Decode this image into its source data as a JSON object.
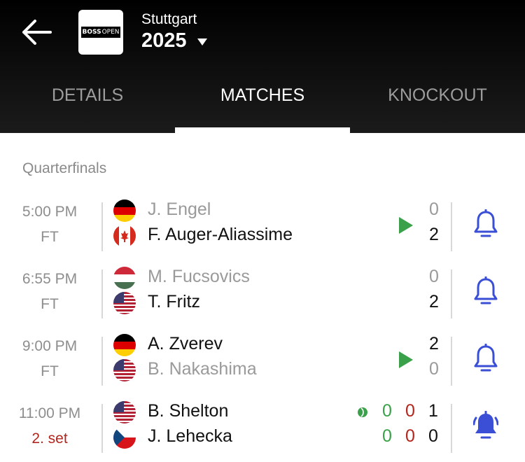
{
  "header": {
    "back_icon": "arrow-left-icon",
    "logo_text_boss": "BOSS",
    "logo_text_open": "OPEN",
    "city": "Stuttgart",
    "year": "2025",
    "year_caret_icon": "caret-down-icon"
  },
  "tabs": [
    {
      "label": "DETAILS",
      "active": false
    },
    {
      "label": "MATCHES",
      "active": true
    },
    {
      "label": "KNOCKOUT",
      "active": false
    }
  ],
  "section_title": "Quarterfinals",
  "matches": [
    {
      "time": "5:00 PM",
      "status": "FT",
      "p1": {
        "name": "J. Engel",
        "flag": "germany",
        "score": "0"
      },
      "p2": {
        "name": "F. Auger-Aliassime",
        "flag": "canada",
        "score": "2"
      },
      "highlights": true,
      "bell": "bell-outline"
    },
    {
      "time": "6:55 PM",
      "status": "FT",
      "p1": {
        "name": "M. Fucsovics",
        "flag": "hungary",
        "score": "0"
      },
      "p2": {
        "name": "T. Fritz",
        "flag": "usa",
        "score": "2"
      },
      "highlights": false,
      "bell": "bell-outline"
    },
    {
      "time": "9:00 PM",
      "status": "FT",
      "p1": {
        "name": "A. Zverev",
        "flag": "germany",
        "score": "2"
      },
      "p2": {
        "name": "B. Nakashima",
        "flag": "usa",
        "score": "0"
      },
      "highlights": true,
      "bell": "bell-outline"
    },
    {
      "time": "11:00 PM",
      "status": "2. set",
      "p1": {
        "name": "B. Shelton",
        "flag": "usa",
        "sets": [
          "0",
          "0",
          "1"
        ]
      },
      "p2": {
        "name": "J. Lehecka",
        "flag": "czech",
        "sets": [
          "0",
          "0",
          "0"
        ]
      },
      "serving": "p1",
      "highlights": false,
      "bell": "bell-ringing-filled"
    }
  ],
  "colors": {
    "accent_blue": "#3a4fd6",
    "play_green": "#3aa14a",
    "live_red": "#b3261e",
    "muted_text": "#9a9a9a"
  }
}
